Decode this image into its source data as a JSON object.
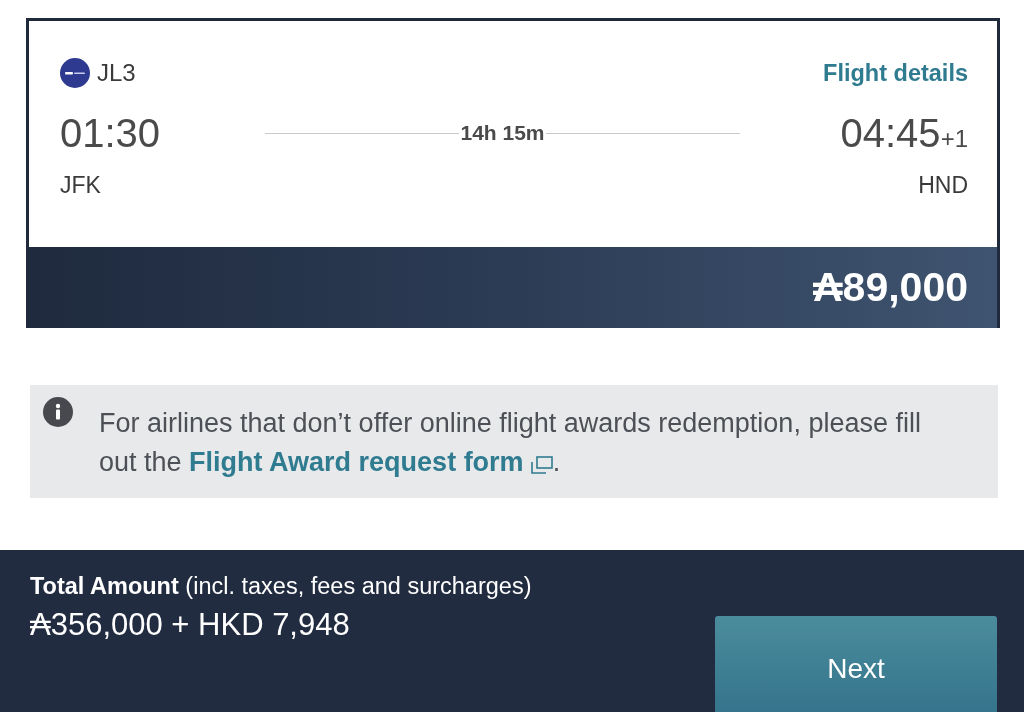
{
  "flight": {
    "flight_number": "JL3",
    "details_link": "Flight details",
    "departure": {
      "time": "01:30",
      "airport": "JFK"
    },
    "duration": "14h 15m",
    "arrival": {
      "time": "04:45",
      "day_offset": "+1",
      "airport": "HND"
    },
    "price": "₳89,000"
  },
  "notice": {
    "text": "For airlines that don’t offer online flight awards redemption, please fill out the",
    "link": "Flight Award request form",
    "end": "."
  },
  "total": {
    "label": "**Total Amount** (incl. taxes, fees and surcharges)",
    "amount": "₳356,000 + HKD 7,948",
    "button": "Next"
  }
}
